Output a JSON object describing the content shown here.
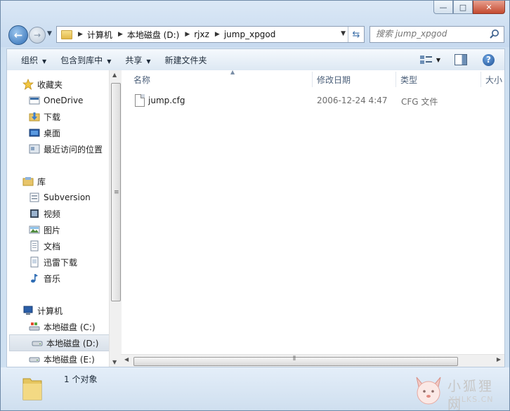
{
  "window": {
    "minimize_glyph": "—",
    "maximize_glyph": "□",
    "close_glyph": "✕"
  },
  "address": {
    "crumbs": [
      "计算机",
      "本地磁盘 (D:)",
      "rjxz",
      "jump_xpgod"
    ]
  },
  "search": {
    "placeholder": "搜索 jump_xpgod"
  },
  "toolbar": {
    "organize": "组织",
    "include_in_library": "包含到库中",
    "share": "共享",
    "new_folder": "新建文件夹"
  },
  "sidebar": {
    "favorites": {
      "label": "收藏夹",
      "items": [
        "OneDrive",
        "下载",
        "桌面",
        "最近访问的位置"
      ]
    },
    "libraries": {
      "label": "库",
      "items": [
        "Subversion",
        "视频",
        "图片",
        "文档",
        "迅雷下载",
        "音乐"
      ]
    },
    "computer": {
      "label": "计算机",
      "items": [
        "本地磁盘 (C:)",
        "本地磁盘 (D:)",
        "本地磁盘 (E:)"
      ]
    }
  },
  "columns": {
    "name": "名称",
    "modified": "修改日期",
    "type": "类型",
    "size": "大小"
  },
  "files": [
    {
      "name": "jump.cfg",
      "modified": "2006-12-24 4:47",
      "type": "CFG 文件"
    }
  ],
  "status": {
    "count_text": "1 个对象"
  },
  "watermark": {
    "title": "小狐狸网",
    "subtitle": "XHLKS.CN"
  },
  "colors": {
    "frame": "#cfe0f1",
    "accent": "#2f6db4",
    "selection": "#d9e1ea"
  }
}
